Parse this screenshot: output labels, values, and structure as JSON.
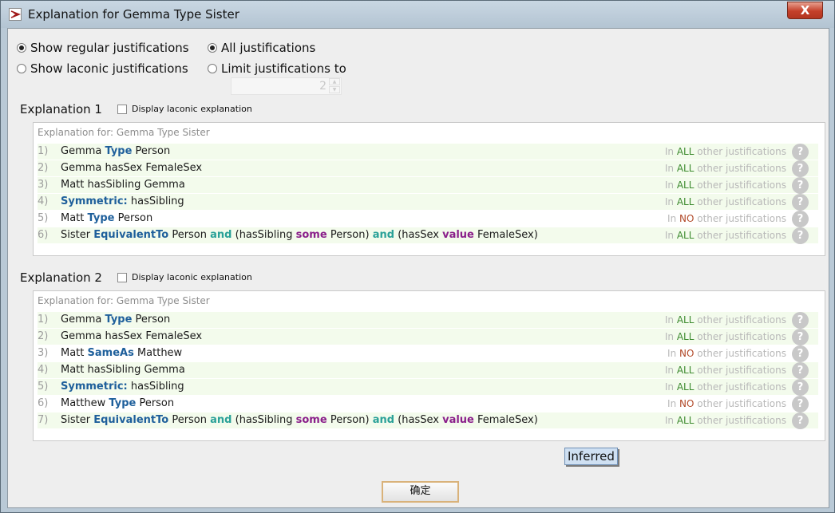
{
  "window": {
    "title": "Explanation for Gemma Type Sister",
    "close_label": "X"
  },
  "options": {
    "regular_label": "Show regular justifications",
    "laconic_label": "Show laconic justifications",
    "all_label": "All justifications",
    "limit_label": "Limit justifications to",
    "limit_value": "2",
    "selected_mode": "regular",
    "selected_scope": "all"
  },
  "explanations": [
    {
      "title": "Explanation 1",
      "checkbox_label": "Display laconic explanation",
      "header": "Explanation for: Gemma Type Sister",
      "rows": [
        {
          "num": "1)",
          "parts": [
            [
              "Gemma ",
              ""
            ],
            [
              "Type",
              "kw"
            ],
            [
              " Person",
              ""
            ]
          ],
          "just": [
            "In ",
            "ALL",
            " other justifications"
          ],
          "shared": true
        },
        {
          "num": "2)",
          "parts": [
            [
              "Gemma hasSex FemaleSex",
              ""
            ]
          ],
          "just": [
            "In ",
            "ALL",
            " other justifications"
          ],
          "shared": true
        },
        {
          "num": "3)",
          "parts": [
            [
              "Matt hasSibling Gemma",
              ""
            ]
          ],
          "just": [
            "In ",
            "ALL",
            " other justifications"
          ],
          "shared": true
        },
        {
          "num": "4)",
          "parts": [
            [
              " ",
              ""
            ],
            [
              "Symmetric:",
              "kw"
            ],
            [
              " hasSibling",
              ""
            ]
          ],
          "just": [
            "In ",
            "ALL",
            " other justifications"
          ],
          "shared": true
        },
        {
          "num": "5)",
          "parts": [
            [
              "Matt ",
              ""
            ],
            [
              "Type",
              "kw"
            ],
            [
              " Person",
              ""
            ]
          ],
          "just": [
            "In ",
            "NO",
            " other justifications"
          ],
          "shared": false
        },
        {
          "num": "6)",
          "parts": [
            [
              "Sister ",
              ""
            ],
            [
              "EquivalentTo",
              "kw"
            ],
            [
              " Person ",
              ""
            ],
            [
              "and",
              "kw2"
            ],
            [
              " (hasSibling ",
              ""
            ],
            [
              "some",
              "kw3"
            ],
            [
              " Person) ",
              ""
            ],
            [
              "and",
              "kw2"
            ],
            [
              " (hasSex ",
              ""
            ],
            [
              "value",
              "kw3"
            ],
            [
              " FemaleSex)",
              ""
            ]
          ],
          "just": [
            "In ",
            "ALL",
            " other justifications"
          ],
          "shared": true
        }
      ]
    },
    {
      "title": "Explanation 2",
      "checkbox_label": "Display laconic explanation",
      "header": "Explanation for: Gemma Type Sister",
      "rows": [
        {
          "num": "1)",
          "parts": [
            [
              "Gemma ",
              ""
            ],
            [
              "Type",
              "kw"
            ],
            [
              " Person",
              ""
            ]
          ],
          "just": [
            "In ",
            "ALL",
            " other justifications"
          ],
          "shared": true
        },
        {
          "num": "2)",
          "parts": [
            [
              "Gemma hasSex FemaleSex",
              ""
            ]
          ],
          "just": [
            "In ",
            "ALL",
            " other justifications"
          ],
          "shared": true
        },
        {
          "num": "3)",
          "parts": [
            [
              "Matt ",
              ""
            ],
            [
              "SameAs",
              "kw"
            ],
            [
              " Matthew",
              ""
            ]
          ],
          "just": [
            "In ",
            "NO",
            " other justifications"
          ],
          "shared": false
        },
        {
          "num": "4)",
          "parts": [
            [
              "Matt hasSibling Gemma",
              ""
            ]
          ],
          "just": [
            "In ",
            "ALL",
            " other justifications"
          ],
          "shared": true
        },
        {
          "num": "5)",
          "parts": [
            [
              " ",
              ""
            ],
            [
              "Symmetric:",
              "kw"
            ],
            [
              " hasSibling",
              ""
            ]
          ],
          "just": [
            "In ",
            "ALL",
            " other justifications"
          ],
          "shared": true
        },
        {
          "num": "6)",
          "parts": [
            [
              "Matthew ",
              ""
            ],
            [
              "Type",
              "kw"
            ],
            [
              " Person",
              ""
            ]
          ],
          "just": [
            "In ",
            "NO",
            " other justifications"
          ],
          "shared": false
        },
        {
          "num": "7)",
          "parts": [
            [
              "Sister ",
              ""
            ],
            [
              "EquivalentTo",
              "kw"
            ],
            [
              " Person ",
              ""
            ],
            [
              "and",
              "kw2"
            ],
            [
              " (hasSibling ",
              ""
            ],
            [
              "some",
              "kw3"
            ],
            [
              " Person) ",
              ""
            ],
            [
              "and",
              "kw2"
            ],
            [
              " (hasSex ",
              ""
            ],
            [
              "value",
              "kw3"
            ],
            [
              " FemaleSex)",
              ""
            ]
          ],
          "just": [
            "In ",
            "ALL",
            " other justifications"
          ],
          "shared": true
        }
      ]
    }
  ],
  "inferred_label": "Inferred",
  "ok_label": "确定",
  "help_glyph": "?",
  "colors": {
    "shared_row": "#f3fbec",
    "all": "#3c8a2e",
    "no": "#b24a2a",
    "keyword": "#1e5f9b"
  }
}
